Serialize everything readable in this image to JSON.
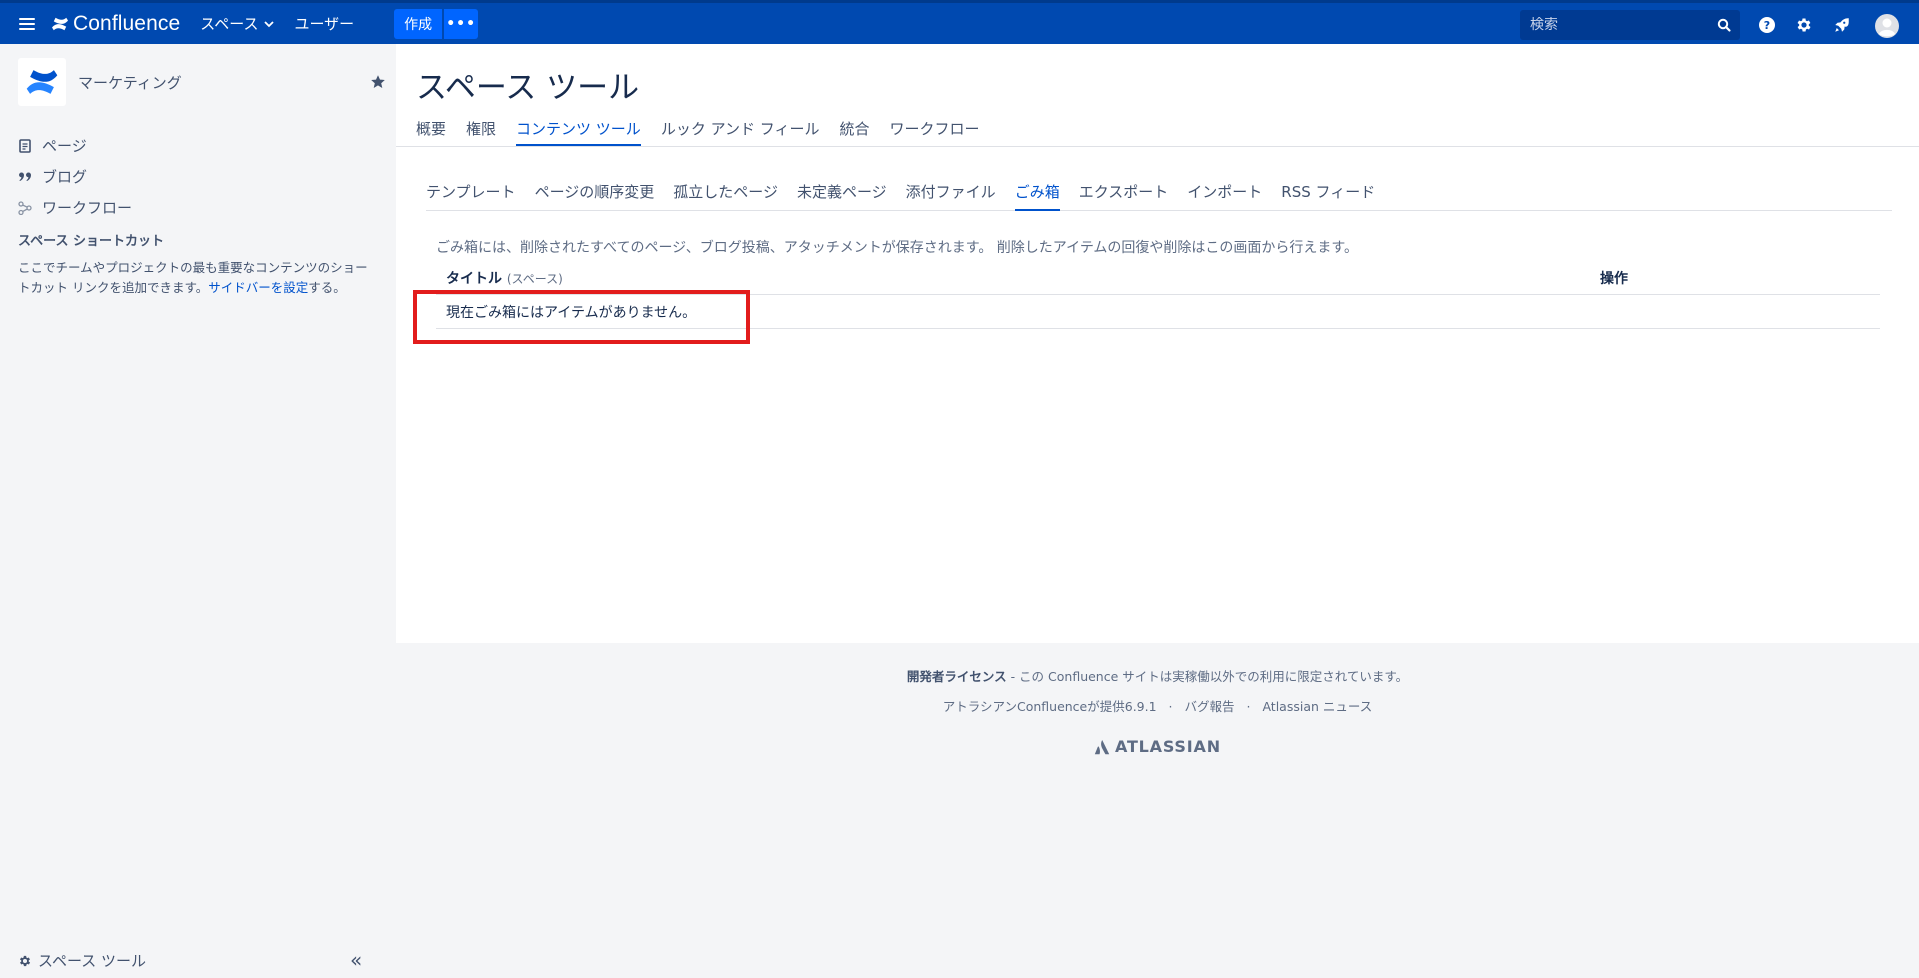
{
  "topbar": {
    "app_name": "Confluence",
    "nav": [
      {
        "label": "スペース",
        "has_dropdown": true
      },
      {
        "label": "ユーザー",
        "has_dropdown": false
      }
    ],
    "create_label": "作成",
    "more_label": "•••",
    "search_placeholder": "検索",
    "help_label": "?"
  },
  "sidebar": {
    "space_name": "マーケティング",
    "nav": [
      {
        "label": "ページ",
        "icon": "page-icon"
      },
      {
        "label": "ブログ",
        "icon": "quote-icon"
      },
      {
        "label": "ワークフロー",
        "icon": "workflow-icon"
      }
    ],
    "shortcut_heading": "スペース ショートカット",
    "shortcut_desc_text": "ここでチームやプロジェクトの最も重要なコンテンツのショートカット リンクを追加できます。",
    "shortcut_desc_link": "サイドバーを設定",
    "shortcut_desc_suffix": "する。",
    "footer_label": "スペース ツール",
    "collapse_label": "«"
  },
  "main": {
    "title": "スペース ツール",
    "tabs": [
      {
        "label": "概要",
        "active": false
      },
      {
        "label": "権限",
        "active": false
      },
      {
        "label": "コンテンツ ツール",
        "active": true
      },
      {
        "label": "ルック アンド フィール",
        "active": false
      },
      {
        "label": "統合",
        "active": false
      },
      {
        "label": "ワークフロー",
        "active": false
      }
    ],
    "subtabs": [
      {
        "label": "テンプレート",
        "active": false
      },
      {
        "label": "ページの順序変更",
        "active": false
      },
      {
        "label": "孤立したページ",
        "active": false
      },
      {
        "label": "未定義ページ",
        "active": false
      },
      {
        "label": "添付ファイル",
        "active": false
      },
      {
        "label": "ごみ箱",
        "active": true
      },
      {
        "label": "エクスポート",
        "active": false
      },
      {
        "label": "インポート",
        "active": false
      },
      {
        "label": "RSS フィード",
        "active": false
      }
    ],
    "description": "ごみ箱には、削除されたすべてのページ、ブログ投稿、アタッチメントが保存されます。 削除したアイテムの回復や削除はこの画面から行えます。",
    "table": {
      "col_title": "タイトル",
      "col_title_sub": "(スペース)",
      "col_ops": "操作",
      "empty_message": "現在ごみ箱にはアイテムがありません。"
    }
  },
  "footer": {
    "license_bold": "開発者ライセンス",
    "license_text": " - この Confluence サイトは実稼働以外での利用に限定されています。",
    "powered_by": "アトラシアンConfluenceが提供6.9.1",
    "bug_report": "バグ報告",
    "news": "Atlassian ニュース",
    "dot": "·",
    "brand": "ATLASSIAN"
  },
  "colors": {
    "topbar": "#0049b0",
    "accent": "#0052cc",
    "highlight": "#e21c1c"
  }
}
